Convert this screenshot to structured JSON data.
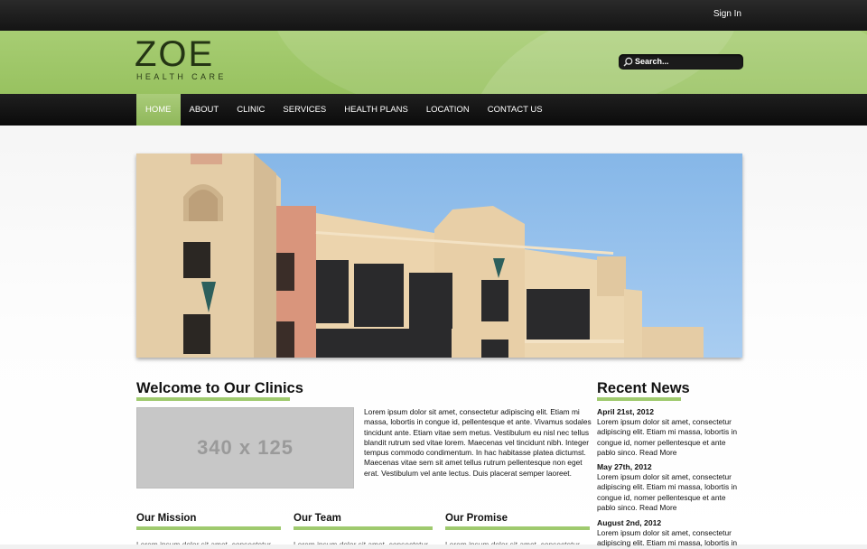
{
  "topbar": {
    "signin_label": "Sign In"
  },
  "logo": {
    "main": "ZOE",
    "sub": "HEALTH CARE"
  },
  "search": {
    "placeholder": "Search..."
  },
  "nav": {
    "items": [
      "HOME",
      "ABOUT",
      "CLINIC",
      "SERVICES",
      "HEALTH PLANS",
      "LOCATION",
      "CONTACT US"
    ],
    "active": "HOME"
  },
  "welcome": {
    "heading": "Welcome to Our Clinics",
    "image_placeholder": "340 x 125",
    "body": "Lorem ipsum dolor sit amet, consectetur adipiscing elit. Etiam mi massa, lobortis in congue id, pellentesque et ante. Vivamus sodales tincidunt ante. Etiam vitae sem metus. Vestibulum eu nisl nec tellus blandit rutrum sed vitae lorem. Maecenas vel tincidunt nibh. Integer tempus commodo condimentum. In hac habitasse platea dictumst. Maecenas vitae sem sit amet tellus rutrum pellentesque non eget erat. Vestibulum vel ante lectus. Duis placerat semper laoreet."
  },
  "news": {
    "heading": "Recent News",
    "items": [
      {
        "date": "April 21st, 2012",
        "body": "Lorem ipsum dolor sit amet, consectetur adipiscing elit. Etiam mi massa, lobortis in congue id, nomer pellentesque et ante pablo sinco.",
        "more": "Read More"
      },
      {
        "date": "May 27th, 2012",
        "body": "Lorem ipsum dolor sit amet, consectetur adipiscing elit. Etiam mi massa, lobortis in congue id, nomer pellentesque et ante pablo sinco.",
        "more": "Read More"
      },
      {
        "date": "August 2nd, 2012",
        "body": "Lorem ipsum dolor sit amet, consectetur adipiscing elit. Etiam mi massa, lobortis in",
        "more": ""
      }
    ]
  },
  "columns": {
    "mission": {
      "heading": "Our Mission",
      "text": "Lorem ipsum dolor sit amet, consectetur"
    },
    "team": {
      "heading": "Our Team",
      "text": "Lorem ipsum dolor sit amet, consectetur"
    },
    "promise": {
      "heading": "Our Promise",
      "text": "Lorem ipsum dolor sit amet, consectetur"
    }
  },
  "colors": {
    "brand_green": "#9fca6e",
    "header_green": "#a7cd73",
    "nav_black": "#151515"
  },
  "icons": {
    "search": "search-icon"
  }
}
